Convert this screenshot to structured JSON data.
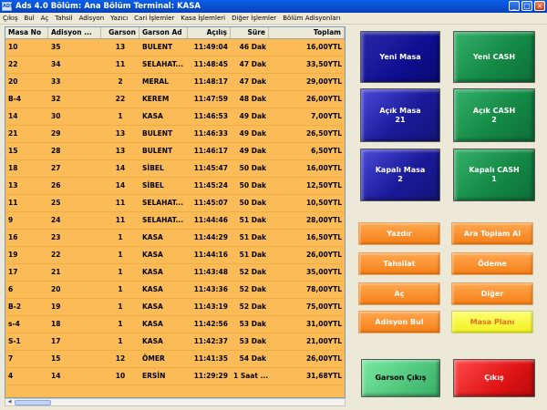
{
  "window": {
    "title": "Ads 4.0 Bölüm: Ana Bölüm Terminal: KASA",
    "icon_text": "ADS",
    "controls": [
      "_",
      "□",
      "×"
    ]
  },
  "menu": [
    "Çıkış",
    "Bul",
    "Aç",
    "Tahsil",
    "Adisyon",
    "Yazıcı",
    "Cari İşlemler",
    "Kasa İşlemleri",
    "Diğer İşlemler",
    "Bölüm Adisyonları"
  ],
  "table": {
    "columns": [
      "Masa No",
      "Adisyon ...",
      "Garson",
      "Garson Ad",
      "Açılış",
      "Süre",
      "Toplam"
    ],
    "rows": [
      [
        "10",
        "35",
        "13",
        "BULENT",
        "11:49:04",
        "46 Dak",
        "16,00YTL"
      ],
      [
        "22",
        "34",
        "11",
        "SELAHAT...",
        "11:48:45",
        "47 Dak",
        "33,50YTL"
      ],
      [
        "20",
        "33",
        "2",
        "MERAL",
        "11:48:17",
        "47 Dak",
        "29,00YTL"
      ],
      [
        "B-4",
        "32",
        "22",
        "KEREM",
        "11:47:59",
        "48 Dak",
        "26,00YTL"
      ],
      [
        "14",
        "30",
        "1",
        "KASA",
        "11:46:53",
        "49 Dak",
        "7,00YTL"
      ],
      [
        "21",
        "29",
        "13",
        "BULENT",
        "11:46:33",
        "49 Dak",
        "26,50YTL"
      ],
      [
        "15",
        "28",
        "13",
        "BULENT",
        "11:46:17",
        "49 Dak",
        "6,50YTL"
      ],
      [
        "18",
        "27",
        "14",
        "SİBEL",
        "11:45:47",
        "50 Dak",
        "16,00YTL"
      ],
      [
        "13",
        "26",
        "14",
        "SİBEL",
        "11:45:24",
        "50 Dak",
        "12,50YTL"
      ],
      [
        "11",
        "25",
        "11",
        "SELAHAT...",
        "11:45:07",
        "50 Dak",
        "10,50YTL"
      ],
      [
        "9",
        "24",
        "11",
        "SELAHAT...",
        "11:44:46",
        "51 Dak",
        "28,00YTL"
      ],
      [
        "16",
        "23",
        "1",
        "KASA",
        "11:44:29",
        "51 Dak",
        "16,50YTL"
      ],
      [
        "19",
        "22",
        "1",
        "KASA",
        "11:44:16",
        "51 Dak",
        "26,00YTL"
      ],
      [
        "17",
        "21",
        "1",
        "KASA",
        "11:43:48",
        "52 Dak",
        "35,00YTL"
      ],
      [
        "6",
        "20",
        "1",
        "KASA",
        "11:43:36",
        "52 Dak",
        "78,00YTL"
      ],
      [
        "B-2",
        "19",
        "1",
        "KASA",
        "11:43:19",
        "52 Dak",
        "75,00YTL"
      ],
      [
        "s-4",
        "18",
        "1",
        "KASA",
        "11:42:56",
        "53 Dak",
        "31,00YTL"
      ],
      [
        "S-1",
        "17",
        "1",
        "KASA",
        "11:42:37",
        "53 Dak",
        "21,00YTL"
      ],
      [
        "7",
        "15",
        "12",
        "ÖMER",
        "11:41:35",
        "54 Dak",
        "26,00YTL"
      ],
      [
        "4",
        "14",
        "10",
        "ERSİN",
        "11:29:29",
        "1 Saat ...",
        "31,68YTL"
      ]
    ]
  },
  "buttons": {
    "yeni_masa": "Yeni Masa",
    "yeni_cash": "Yeni CASH",
    "acik_masa": "Açık Masa\n21",
    "acik_cash": "Açık CASH\n2",
    "kapali_masa": "Kapalı Masa\n2",
    "kapali_cash": "Kapalı CASH\n1",
    "yazdir": "Yazdır",
    "ara_toplam": "Ara Toplam Al",
    "tahsilat": "Tahsilat",
    "odeme": "Ödeme",
    "ac": "Aç",
    "diger": "Diğer",
    "adisyon_bul": "Adisyon Bul",
    "masa_plani": "Masa Planı",
    "garson_cikis": "Garson Çıkış",
    "cikis": "Çıkış"
  },
  "colors": {
    "grid_bg": "#fbbc57",
    "title_bar": "#0a5ee8",
    "blue_button": "#1a1a9a",
    "green_button": "#148a45",
    "orange_button": "#f77e14",
    "yellow_button": "#f0f020",
    "red_button": "#e01414"
  }
}
